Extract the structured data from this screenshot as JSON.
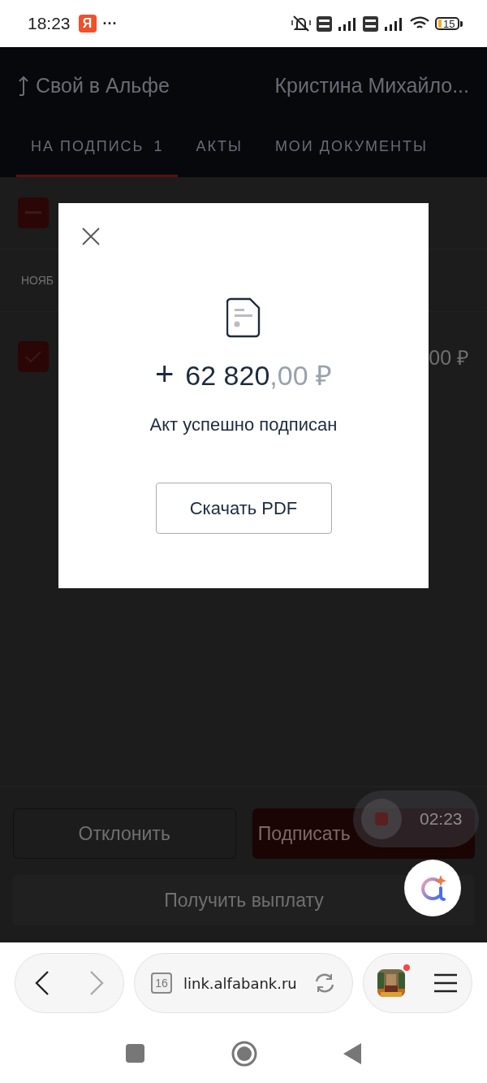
{
  "status_bar": {
    "time": "18:23",
    "app_badge": "Я",
    "more": "···",
    "battery": "15"
  },
  "header": {
    "title": "Свой в Альфе",
    "user": "Кристина Михайло..."
  },
  "tabs": [
    {
      "label": "НА ПОДПИСЬ",
      "count": "1",
      "selected": true
    },
    {
      "label": "АКТЫ",
      "selected": false
    },
    {
      "label": "МОИ ДОКУМЕНТЫ",
      "selected": false
    }
  ],
  "select_all": {
    "indeterminate": true
  },
  "group_label": "НОЯБ",
  "acts": [
    {
      "checked": true,
      "amount": "00 ₽"
    }
  ],
  "actions": [
    {
      "label": "Отклонить",
      "kind": "outline"
    },
    {
      "label": "Подписать",
      "kind": "primary"
    },
    {
      "label": "Получить выплату",
      "kind": "wide"
    }
  ],
  "recording": {
    "time": "02:23"
  },
  "dialog": {
    "sign": "+",
    "amount": "62 820",
    "fraction": ",00 ₽",
    "message": "Акт успешно подписан",
    "button": "Скачать PDF"
  },
  "browser": {
    "back_disabled": false,
    "forward_disabled": true,
    "tab_count": "16",
    "url": "link.alfabank.ru"
  }
}
